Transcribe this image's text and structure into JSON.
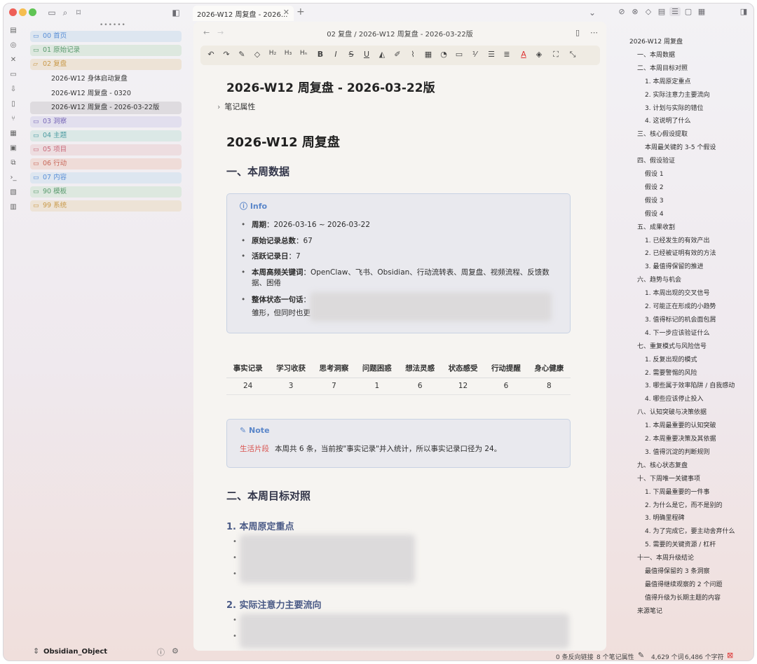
{
  "tab": {
    "title": "2026-W12 周复盘 - 2026..."
  },
  "breadcrumb": "02 复盘 / 2026-W12 周复盘 - 2026-03-22版",
  "file_tree": {
    "items": [
      {
        "label": "00 首页",
        "color": "#5a8fd6",
        "bg": "#dde6f0"
      },
      {
        "label": "01 原始记录",
        "color": "#5a9a6e",
        "bg": "#dde8df"
      },
      {
        "label": "02 复盘",
        "color": "#c99a4a",
        "bg": "#ede3d6"
      },
      {
        "label": "03 洞察",
        "color": "#7a6ab8",
        "bg": "#e2dfee"
      },
      {
        "label": "04 主题",
        "color": "#4a9aa0",
        "bg": "#dbe8e6"
      },
      {
        "label": "05 项目",
        "color": "#c86a7a",
        "bg": "#eddde0"
      },
      {
        "label": "06 行动",
        "color": "#c8685a",
        "bg": "#efdcd8"
      },
      {
        "label": "07 内容",
        "color": "#5a8fd6",
        "bg": "#dde6f0"
      },
      {
        "label": "90 模板",
        "color": "#5a9a6e",
        "bg": "#dde8df"
      },
      {
        "label": "99 系统",
        "color": "#c99a4a",
        "bg": "#ede3d6"
      }
    ],
    "files": [
      "2026-W12 身体启动复盘",
      "2026-W12 周复盘 - 0320",
      "2026-W12 周复盘 - 2026-03-22版"
    ]
  },
  "vault": {
    "name": "Obsidian_Object"
  },
  "doc": {
    "title": "2026-W12 周复盘 - 2026-03-22版",
    "properties_label": "笔记属性",
    "h1": "2026-W12 周复盘",
    "section1": "一、本周数据",
    "info_title": "Info",
    "info_items": [
      {
        "key": "周期",
        "value": "：2026-03-16 ~ 2026-03-22"
      },
      {
        "key": "原始记录总数",
        "value": "：67"
      },
      {
        "key": "活跃记录日",
        "value": "：7"
      },
      {
        "key": "本周高频关键词",
        "value": "：OpenClaw、飞书、Obsidian、行动流转表、周复盘、视频流程、反馈数据、困倦"
      },
      {
        "key": "整体状态一句话",
        "value": "："
      }
    ],
    "info_last_line": "雏形，但同时也更",
    "table": {
      "headers": [
        "事实记录",
        "学习收获",
        "思考洞察",
        "问题困惑",
        "想法灵感",
        "状态感受",
        "行动提醒",
        "身心健康"
      ],
      "values": [
        "24",
        "3",
        "7",
        "1",
        "6",
        "12",
        "6",
        "8"
      ]
    },
    "note_title": "Note",
    "note_tag": "生活片段",
    "note_text": "本周共 6 条，当前按\"事实记录\"并入统计，所以事实记录口径为 24。",
    "section2": "二、本周目标对照",
    "sub1": "1. 本周原定重点",
    "sub2": "2. 实际注意力主要流向"
  },
  "outline": [
    {
      "text": "2026-W12 周复盘",
      "level": 0
    },
    {
      "text": "一、本周数据",
      "level": 1
    },
    {
      "text": "二、本周目标对照",
      "level": 1
    },
    {
      "text": "1. 本周原定重点",
      "level": 2
    },
    {
      "text": "2. 实际注意力主要流向",
      "level": 2
    },
    {
      "text": "3. 计划与实际的错位",
      "level": 2
    },
    {
      "text": "4. 这说明了什么",
      "level": 2
    },
    {
      "text": "三、核心假设提取",
      "level": 1
    },
    {
      "text": "本周最关键的 3-5 个假设",
      "level": 2
    },
    {
      "text": "四、假设验证",
      "level": 1
    },
    {
      "text": "假设 1",
      "level": 2
    },
    {
      "text": "假设 2",
      "level": 2
    },
    {
      "text": "假设 3",
      "level": 2
    },
    {
      "text": "假设 4",
      "level": 2
    },
    {
      "text": "五、成果收割",
      "level": 1
    },
    {
      "text": "1. 已经发生的有效产出",
      "level": 2
    },
    {
      "text": "2. 已经被证明有效的方法",
      "level": 2
    },
    {
      "text": "3. 最值得保留的推进",
      "level": 2
    },
    {
      "text": "六、趋势与机会",
      "level": 1
    },
    {
      "text": "1. 本周出现的交叉信号",
      "level": 2
    },
    {
      "text": "2. 可能正在形成的小趋势",
      "level": 2
    },
    {
      "text": "3. 值得标记的机会面包屑",
      "level": 2
    },
    {
      "text": "4. 下一步应该验证什么",
      "level": 2
    },
    {
      "text": "七、重复模式与风险信号",
      "level": 1
    },
    {
      "text": "1. 反复出现的模式",
      "level": 2
    },
    {
      "text": "2. 需要警惕的风险",
      "level": 2
    },
    {
      "text": "3. 哪些属于效率陷阱 / 自我感动",
      "level": 2
    },
    {
      "text": "4. 哪些应该停止投入",
      "level": 2
    },
    {
      "text": "八、认知突破与决策依据",
      "level": 1
    },
    {
      "text": "1. 本周最重要的认知突破",
      "level": 2
    },
    {
      "text": "2. 本周重要决策及其依据",
      "level": 2
    },
    {
      "text": "3. 值得沉淀的判断规则",
      "level": 2
    },
    {
      "text": "九、核心状态复盘",
      "level": 1
    },
    {
      "text": "十、下周唯一关键事项",
      "level": 1
    },
    {
      "text": "1. 下周最重要的一件事",
      "level": 2
    },
    {
      "text": "2. 为什么是它，而不是别的",
      "level": 2
    },
    {
      "text": "3. 明确里程碑",
      "level": 2
    },
    {
      "text": "4. 为了完成它，要主动舍弃什么",
      "level": 2
    },
    {
      "text": "5. 需要的关键资源 / 杠杆",
      "level": 2
    },
    {
      "text": "十一、本周升级结论",
      "level": 1
    },
    {
      "text": "最值得保留的 3 条洞察",
      "level": 2
    },
    {
      "text": "最值得继续观察的 2 个问题",
      "level": 2
    },
    {
      "text": "值得升级为长期主题的内容",
      "level": 2
    },
    {
      "text": "来源笔记",
      "level": 1
    }
  ],
  "status": {
    "backlinks": "0 条反向链接",
    "properties": "8 个笔记属性",
    "words": "4,629 个词",
    "chars": "6,486 个字符"
  }
}
